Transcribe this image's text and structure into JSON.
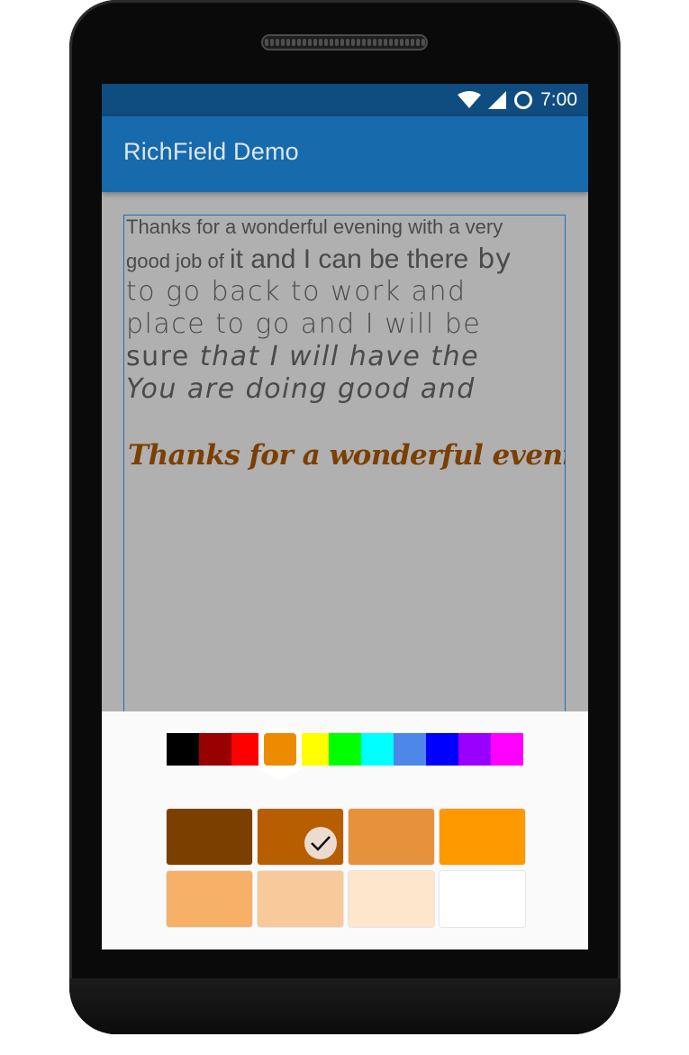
{
  "statusbar": {
    "time": "7:00",
    "icons": [
      "wifi-icon",
      "cell-signal-icon",
      "circle-icon"
    ]
  },
  "appbar": {
    "title": "RichField Demo"
  },
  "editor": {
    "line1": "Thanks for a wonderful evening with a very",
    "line2_small": "good job of ",
    "line2_big": "it and I can be there",
    "line2_round": " by",
    "line3": "to go back to work and",
    "line4": "place to go and I will be",
    "line5_normal": "sure ",
    "line5_italic": "that I will have the",
    "line6": "You are doing good and",
    "line7": "Thanks for a wonderful evening",
    "line7_color": "#7b3f00"
  },
  "color_picker": {
    "primary_colors": [
      "#000000",
      "#990000",
      "#ff0000",
      "#ec8b00",
      "#ffff00",
      "#00ff00",
      "#00ffff",
      "#4d87e7",
      "#0000ff",
      "#9900ff",
      "#ff00ff"
    ],
    "selected_primary_index": 3,
    "shades": [
      "#7b4000",
      "#b65e00",
      "#e6913b",
      "#ff9900",
      "#f6b067",
      "#f8c99a",
      "#fde6cc",
      "#ffffff"
    ],
    "selected_shade_index": 1
  }
}
